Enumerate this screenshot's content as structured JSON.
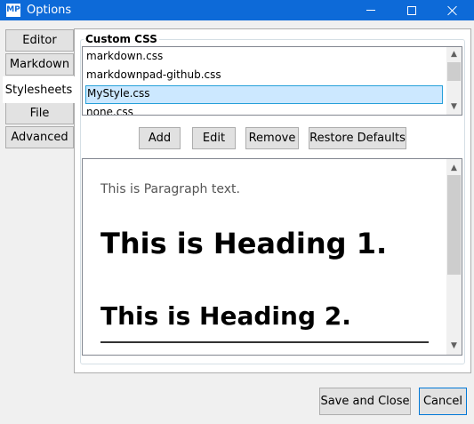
{
  "window": {
    "app_icon_text": "MP",
    "title": "Options"
  },
  "tabs": [
    {
      "label": "Editor",
      "selected": false
    },
    {
      "label": "Markdown",
      "selected": false
    },
    {
      "label": "Stylesheets",
      "selected": true
    },
    {
      "label": "File",
      "selected": false
    },
    {
      "label": "Advanced",
      "selected": false
    }
  ],
  "custom_css": {
    "group_label": "Custom CSS",
    "items": [
      "markdown.css",
      "markdownpad-github.css",
      "MyStyle.css",
      "none.css"
    ],
    "selected_item": "MyStyle.css"
  },
  "buttons": {
    "add": "Add",
    "edit": "Edit",
    "remove": "Remove",
    "restore_defaults": "Restore Defaults"
  },
  "preview": {
    "paragraph": "This is Paragraph text.",
    "heading1": "This is Heading 1.",
    "heading2": "This is Heading 2."
  },
  "footer": {
    "save_and_close": "Save and Close",
    "cancel": "Cancel"
  },
  "colors": {
    "titlebar": "#0d6ad8",
    "selection_fill": "#cce8ff",
    "selection_border": "#26a0da",
    "default_button_border": "#0078d7"
  }
}
